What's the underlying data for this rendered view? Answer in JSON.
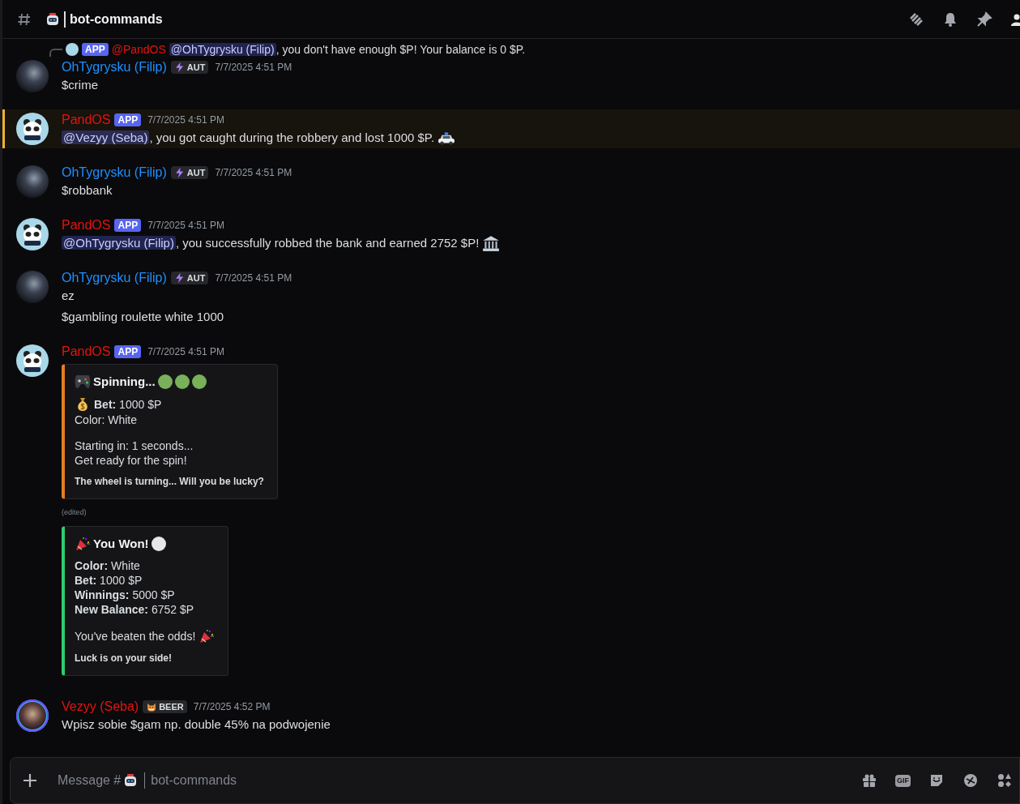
{
  "header": {
    "channel": "bot-commands"
  },
  "reply": {
    "badge": "APP",
    "author": "@PandOS",
    "mention": "@OhTygrysku (Filip)",
    "text": ", you don't have enough $P! Your balance is 0 $P."
  },
  "messages": [
    {
      "author": "OhTygrysku (Filip)",
      "color": "#1e90ff",
      "kind": "user",
      "tag": {
        "kind": "guild",
        "label": "AUT"
      },
      "timestamp": "7/7/2025 4:51 PM",
      "highlighted": false,
      "blocks": [
        {
          "kind": "text",
          "text": "$crime"
        }
      ]
    },
    {
      "author": "PandOS",
      "color": "#e3140e",
      "kind": "bot",
      "tag": {
        "kind": "app",
        "label": "APP"
      },
      "timestamp": "7/7/2025 4:51 PM",
      "highlighted": true,
      "blocks": [
        {
          "kind": "text",
          "mention": "@Vezyy (Seba)",
          "text": ", you got caught during the robbery and lost 1000 $P."
        }
      ]
    },
    {
      "author": "OhTygrysku (Filip)",
      "color": "#1e90ff",
      "kind": "user",
      "tag": {
        "kind": "guild",
        "label": "AUT"
      },
      "timestamp": "7/7/2025 4:51 PM",
      "highlighted": false,
      "blocks": [
        {
          "kind": "text",
          "text": "$robbank"
        }
      ]
    },
    {
      "author": "PandOS",
      "color": "#e3140e",
      "kind": "bot",
      "tag": {
        "kind": "app",
        "label": "APP"
      },
      "timestamp": "7/7/2025 4:51 PM",
      "highlighted": false,
      "blocks": [
        {
          "kind": "text",
          "mention": "@OhTygrysku (Filip)",
          "text": ", you successfully robbed the bank and earned 2752 $P!"
        }
      ]
    },
    {
      "author": "OhTygrysku (Filip)",
      "color": "#1e90ff",
      "kind": "user",
      "tag": {
        "kind": "guild",
        "label": "AUT"
      },
      "timestamp": "7/7/2025 4:51 PM",
      "highlighted": false,
      "blocks": [
        {
          "kind": "text",
          "text": "ez"
        },
        {
          "kind": "text",
          "text": "$gambling roulette white 1000"
        }
      ]
    },
    {
      "author": "PandOS",
      "color": "#e3140e",
      "kind": "bot",
      "tag": {
        "kind": "app",
        "label": "APP"
      },
      "timestamp": "7/7/2025 4:51 PM",
      "highlighted": false,
      "blocks": [
        {
          "kind": "embed",
          "color": "#e67e22",
          "title": "Spinning...",
          "title_circles": [
            {
              "color": "#78b159"
            },
            {
              "color": "#78b159"
            },
            {
              "color": "#78b159"
            }
          ],
          "paragraphs": [
            [
              "**Bet:** 1000 $P",
              "Color: White"
            ],
            [
              "Starting in: 1 seconds...",
              "Get ready for the spin!"
            ]
          ],
          "footer": "The wheel is turning... Will you be lucky?"
        },
        {
          "kind": "note",
          "text": "(edited)"
        },
        {
          "kind": "embed",
          "color": "#2ecc71",
          "title": "You Won!",
          "title_circles": [
            {
              "color": "#e6e7e8"
            }
          ],
          "paragraphs": [
            [
              "**Color:** White",
              "**Bet:** 1000 $P",
              "**Winnings:** 5000 $P",
              "**New Balance:** 6752 $P"
            ],
            [
              "You've beaten the odds!"
            ]
          ],
          "footer": "Luck is on your side!"
        }
      ]
    },
    {
      "author": "Vezyy (Seba)",
      "color": "#e3140e",
      "kind": "user",
      "tag": {
        "kind": "guild",
        "label": "BEER"
      },
      "timestamp": "7/7/2025 4:52 PM",
      "highlighted": false,
      "blocks": [
        {
          "kind": "text",
          "text": "Wpisz sobie $gam np. double 45% na podwojenie"
        }
      ]
    }
  ],
  "composer": {
    "placeholder_prefix": "Message #",
    "placeholder_channel": "bot-commands",
    "gif_label": "GIF"
  }
}
